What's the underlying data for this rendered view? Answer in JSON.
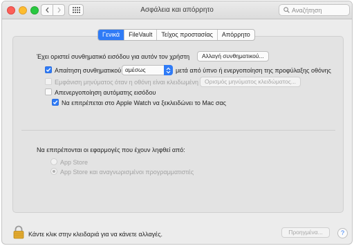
{
  "window": {
    "title": "Ασφάλεια και απόρρητο"
  },
  "toolbar": {
    "back_icon": "chevron-left-icon",
    "forward_icon": "chevron-right-icon",
    "grid_icon": "show-all-grid-icon",
    "search_placeholder": "Αναζήτηση"
  },
  "tabs": [
    {
      "label": "Γενικά",
      "active": true
    },
    {
      "label": "FileVault",
      "active": false
    },
    {
      "label": "Τείχος προστασίας",
      "active": false
    },
    {
      "label": "Απόρρητο",
      "active": false
    }
  ],
  "general": {
    "login_password_text": "Έχει οριστεί συνθηματικό εισόδου για αυτόν τον χρήστη",
    "change_password_button": "Αλλαγή συνθηματικού...",
    "require_password_label": "Απαίτηση συνθηματικού",
    "require_password_checked": true,
    "require_password_value": "αμέσως",
    "require_password_suffix": "μετά από ύπνο ή ενεργοποίηση της προφύλαξης οθόνης",
    "show_message_label": "Εμφάνιση μηνύματος όταν η οθόνη είναι κλειδωμένη",
    "show_message_checked": false,
    "set_lock_message_button": "Ορισμός μηνύματος κλειδώματος...",
    "disable_auto_login_label": "Απενεργοποίηση αυτόματης εισόδου",
    "disable_auto_login_checked": false,
    "apple_watch_label": "Να επιτρέπεται στο Apple Watch να ξεκλειδώνει το Mac σας",
    "apple_watch_checked": true,
    "apps_downloaded_label": "Να επιτρέπονται οι εφαρμογές που έχουν ληφθεί από:",
    "radio_options": [
      {
        "label": "App Store",
        "selected": false
      },
      {
        "label": "App Store και αναγνωρισμένοι προγραμματιστές",
        "selected": true
      }
    ]
  },
  "footer": {
    "lock_icon": "lock-icon",
    "lock_text": "Κάντε κλικ στην κλειδαριά για να κάνετε αλλαγές.",
    "advanced_button": "Προηγμένα...",
    "help_label": "?"
  },
  "colors": {
    "accent": "#2f7bf6",
    "lock_gold": "#e0a82e"
  }
}
